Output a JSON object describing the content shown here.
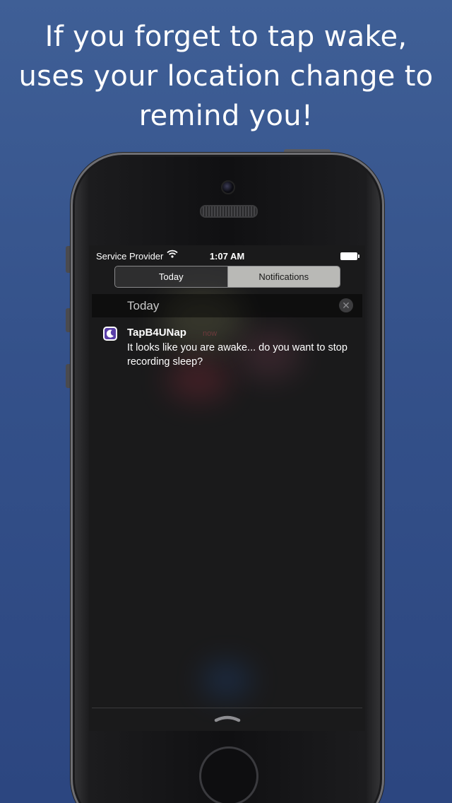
{
  "headline": {
    "line1": "If you forget to tap wake,",
    "line2": "uses your location change to",
    "line3": "remind you!"
  },
  "status_bar": {
    "carrier": "Service Provider",
    "time": "1:07 AM",
    "icons": [
      "wifi-icon",
      "battery-icon"
    ]
  },
  "tabs": [
    {
      "label": "Today",
      "selected": false
    },
    {
      "label": "Notifications",
      "selected": true
    }
  ],
  "section": {
    "title": "Today",
    "clear_symbol": "✕"
  },
  "notification": {
    "app_name": "TapB4UNap",
    "time": "now",
    "body": "It looks like you are awake... do you want to stop recording sleep?",
    "icon": "moon-app-icon"
  },
  "colors": {
    "background": "#34518a",
    "screen": "#1a1a1b",
    "active_tab": "#b9b9b6",
    "notif_time": "#6e3a3d"
  }
}
